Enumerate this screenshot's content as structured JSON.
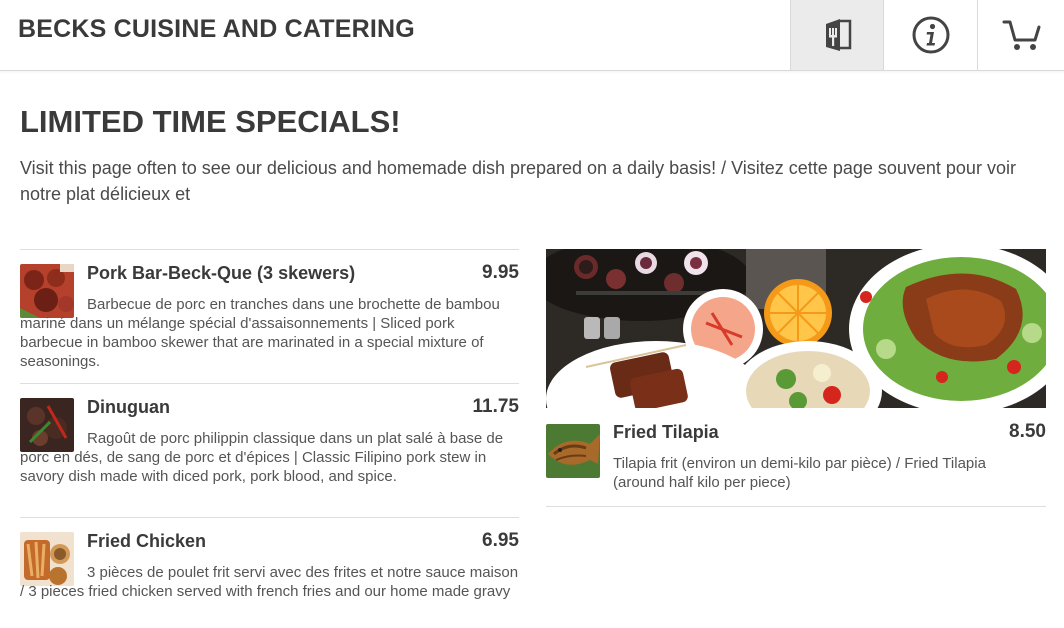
{
  "header": {
    "brand": "BECKS CUISINE AND CATERING",
    "buttons": {
      "menu_icon": "menu-book-icon",
      "info_icon": "info-icon",
      "cart_icon": "cart-icon"
    }
  },
  "page": {
    "title": "LIMITED TIME SPECIALS!",
    "intro": "Visit this page often to see our delicious and homemade dish prepared on a daily basis! / Visitez cette page souvent pour voir notre plat délicieux et"
  },
  "items": [
    {
      "name": "Pork Bar-Beck-Que (3 skewers)",
      "price": "9.95",
      "description": "Barbecue de porc en tranches dans une brochette de bambou mariné dans un mélange spécial d'assaisonnements | Sliced pork barbecue in bamboo skewer that are marinated in a special mixture of seasonings."
    },
    {
      "name": "Dinuguan",
      "price": "11.75",
      "description": "Ragoût de porc philippin classique dans un plat salé à base de porc en dés, de sang de porc et d'épices | Classic Filipino pork stew in savory dish made with diced pork, pork blood, and spice."
    },
    {
      "name": "Fried Chicken",
      "price": "6.95",
      "description": "3 pièces de poulet frit servi avec des frites et notre sauce maison / 3 pieces fried chicken served with french fries and our home made gravy"
    },
    {
      "name": "Fried Tilapia",
      "price": "8.50",
      "description": "Tilapia frit (environ un demi-kilo par pièce) / Fried Tilapia (around half kilo per piece)"
    }
  ],
  "colors": {
    "text_dark": "#3a3a3a",
    "active_tab_bg": "#ebebeb",
    "divider": "#dedede"
  }
}
